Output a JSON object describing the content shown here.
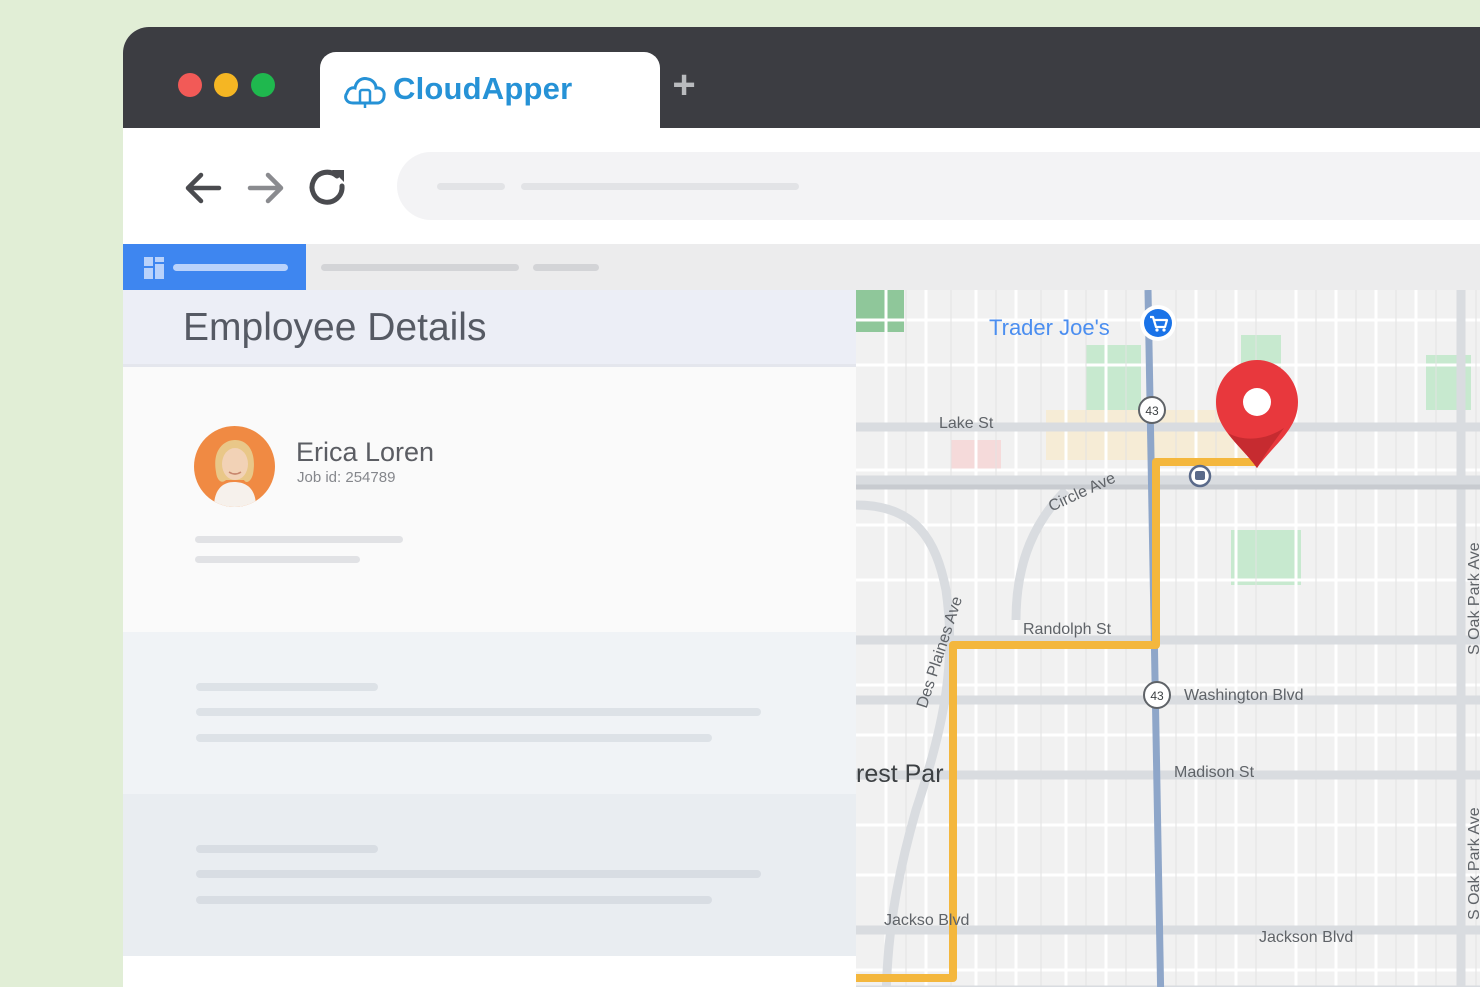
{
  "browser": {
    "tab_title": "CloudApper",
    "new_tab_symbol": "+",
    "accent": "#2692d6"
  },
  "nav_icons": [
    "back-arrow-icon",
    "forward-arrow-icon",
    "reload-icon"
  ],
  "app": {
    "brand_color": "#3e86f0",
    "panel_title": "Employee Details"
  },
  "employee": {
    "name": "Erica Loren",
    "job_id": "Job id: 254789"
  },
  "map": {
    "poi": "Trader Joe's",
    "route_color": "#f4b73d",
    "pin_color": "#e8383d",
    "streets": {
      "lake": "Lake St",
      "circle": "Circle Ave",
      "randolph": "Randolph St",
      "desplaines": "Des Plaines Ave",
      "washington": "Washington Blvd",
      "madison": "Madison St",
      "jackson_left": "Jackso  Blvd",
      "jackson_right": "Jackson Blvd",
      "oak_park_top": "S Oak Park Ave",
      "oak_park_bottom": "S Oak Park Ave"
    },
    "area": "rest Par",
    "route_shields": [
      "43",
      "43"
    ]
  }
}
